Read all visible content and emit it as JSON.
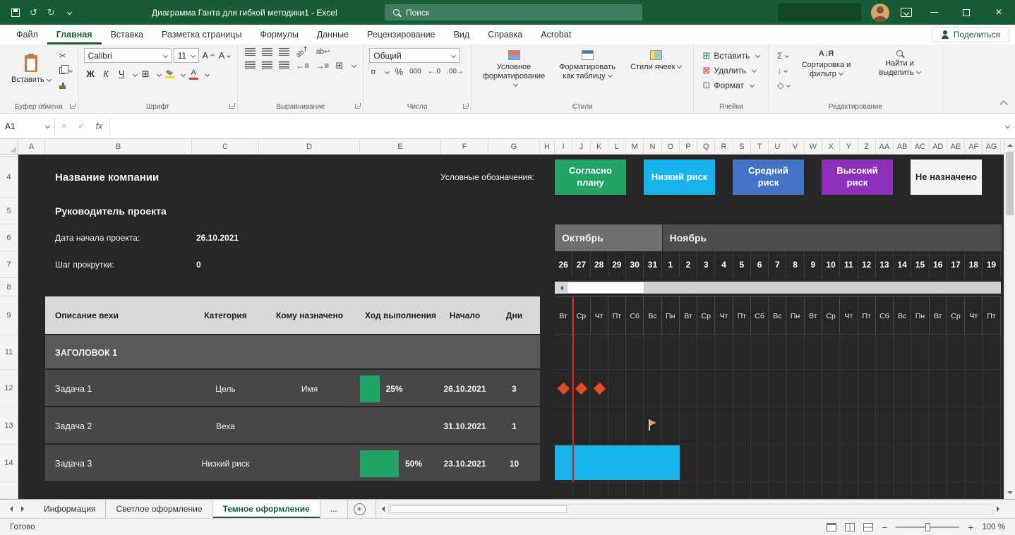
{
  "titlebar": {
    "title": "Диаграмма Ганта для гибкой методики1 - Excel",
    "search_placeholder": "Поиск"
  },
  "ribbon_tabs": {
    "items": [
      "Файл",
      "Главная",
      "Вставка",
      "Разметка страницы",
      "Формулы",
      "Данные",
      "Рецензирование",
      "Вид",
      "Справка",
      "Acrobat"
    ],
    "active": "Главная",
    "share_label": "Поделиться"
  },
  "ribbon": {
    "clipboard": {
      "paste": "Вставить",
      "label": "Буфер обмена"
    },
    "font": {
      "family": "Calibri",
      "size": "11",
      "bold": "Ж",
      "italic": "К",
      "underline": "Ч",
      "label": "Шрифт"
    },
    "alignment": {
      "label": "Выравнивание"
    },
    "number": {
      "format": "Общий",
      "percent": "%",
      "zeros": "000",
      "label": "Число"
    },
    "styles": {
      "conditional": "Условное форматирование",
      "as_table": "Форматировать как таблицу",
      "cell_styles": "Стили ячеек",
      "label": "Стили"
    },
    "cells": {
      "insert": "Вставить",
      "delete": "Удалить",
      "format": "Формат",
      "label": "Ячейки"
    },
    "editing": {
      "autosum": "Σ",
      "sort": "Сортировка и фильтр",
      "find": "Найти и выделить",
      "label": "Редактирование"
    }
  },
  "formula_bar": {
    "name_box": "A1",
    "fx": "fx"
  },
  "grid": {
    "columns": [
      "A",
      "B",
      "C",
      "D",
      "E",
      "F",
      "G",
      "H",
      "I",
      "J",
      "K",
      "L",
      "M",
      "N",
      "O",
      "P",
      "Q",
      "R",
      "S",
      "T",
      "U",
      "V",
      "W",
      "X",
      "Y",
      "Z",
      "AA",
      "AB",
      "AC",
      "AD",
      "AE",
      "AF",
      "AG"
    ],
    "rows": [
      "4",
      "5",
      "6",
      "7",
      "8",
      "9",
      "11",
      "12",
      "13",
      "14"
    ]
  },
  "sheet": {
    "company_name": "Название компании",
    "legend_label": "Условные обозначения:",
    "legend": [
      {
        "label": "Согласно плану",
        "color": "#21A366",
        "text": "#FFFFFF"
      },
      {
        "label": "Низкий риск",
        "color": "#18B2EC",
        "text": "#FFFFFF"
      },
      {
        "label": "Средний риск",
        "color": "#4472C4",
        "text": "#FFFFFF"
      },
      {
        "label": "Высокий риск",
        "color": "#8C30BC",
        "text": "#FFFFFF"
      },
      {
        "label": "Не назначено",
        "color": "#F2F2F2",
        "text": "#262626"
      }
    ],
    "project_manager": "Руководитель проекта",
    "start_date_label": "Дата начала проекта:",
    "start_date": "26.10.2021",
    "scroll_step_label": "Шаг прокрутки:",
    "scroll_step": "0",
    "months": [
      {
        "name": "Октябрь",
        "days": 6
      },
      {
        "name": "Ноябрь",
        "days": 19
      }
    ],
    "days": [
      "26",
      "27",
      "28",
      "29",
      "30",
      "31",
      "1",
      "2",
      "3",
      "4",
      "5",
      "6",
      "7",
      "8",
      "9",
      "10",
      "11",
      "12",
      "13",
      "14",
      "15",
      "16",
      "17",
      "18",
      "19"
    ],
    "weekdays": [
      "Вт",
      "Ср",
      "Чт",
      "Пт",
      "Сб",
      "Вс",
      "Пн",
      "Вт",
      "Ср",
      "Чт",
      "Пт",
      "Сб",
      "Вс",
      "Пн",
      "Вт",
      "Ср",
      "Чт",
      "Пт",
      "Сб",
      "Вс",
      "Пн",
      "Вт",
      "Ср",
      "Чт",
      "Пт"
    ],
    "table_headers": [
      "Описание вехи",
      "Категория",
      "Кому назначено",
      "Ход выполнения",
      "Начало",
      "Дни"
    ],
    "section_title": "ЗАГОЛОВОК 1",
    "tasks": [
      {
        "name": "Задача 1",
        "category": "Цель",
        "assignee": "Имя",
        "progress_pct": 25,
        "progress_label": "25%",
        "start": "26.10.2021",
        "days": "3",
        "marks": {
          "type": "diamonds",
          "day_indices": [
            0,
            1,
            2
          ],
          "color": "#E0502D"
        }
      },
      {
        "name": "Задача 2",
        "category": "Веха",
        "assignee": "",
        "progress_pct": 0,
        "progress_label": "",
        "start": "31.10.2021",
        "days": "1",
        "marks": {
          "type": "flag",
          "day_indices": [
            5
          ],
          "color": "#F2A33A"
        }
      },
      {
        "name": "Задача 3",
        "category": "Низкий риск",
        "assignee": "",
        "progress_pct": 50,
        "progress_label": "50%",
        "start": "23.10.2021",
        "days": "10",
        "marks": {
          "type": "bar",
          "from": 0,
          "to": 6,
          "color": "#18B2EC"
        }
      }
    ],
    "today_line_day_index": 1
  },
  "sheet_tabs": {
    "items": [
      "Информация",
      "Светлое оформление",
      "Темное оформление"
    ],
    "active": "Темное оформление",
    "more": "..."
  },
  "status_bar": {
    "mode": "Готово",
    "zoom": "100 %"
  }
}
